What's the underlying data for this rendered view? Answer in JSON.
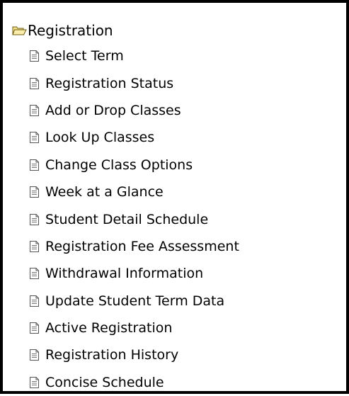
{
  "menu": {
    "folder": {
      "label": "Registration",
      "icon": "open-folder-icon"
    },
    "items": [
      {
        "label": "Select Term",
        "icon": "document-icon"
      },
      {
        "label": "Registration Status",
        "icon": "document-icon"
      },
      {
        "label": "Add or Drop Classes",
        "icon": "document-icon"
      },
      {
        "label": "Look Up Classes",
        "icon": "document-icon"
      },
      {
        "label": "Change Class Options",
        "icon": "document-icon"
      },
      {
        "label": "Week at a Glance",
        "icon": "document-icon"
      },
      {
        "label": "Student Detail Schedule",
        "icon": "document-icon"
      },
      {
        "label": "Registration Fee Assessment",
        "icon": "document-icon"
      },
      {
        "label": "Withdrawal Information",
        "icon": "document-icon"
      },
      {
        "label": "Update Student Term Data",
        "icon": "document-icon"
      },
      {
        "label": "Active Registration",
        "icon": "document-icon"
      },
      {
        "label": "Registration History",
        "icon": "document-icon"
      },
      {
        "label": "Concise Schedule",
        "icon": "document-icon"
      }
    ]
  },
  "colors": {
    "border": "#000000",
    "text": "#000000",
    "folder_fill": "#f6e08a",
    "folder_stroke": "#6b5a10",
    "document_fill": "#ffffff",
    "document_stroke": "#555555"
  }
}
